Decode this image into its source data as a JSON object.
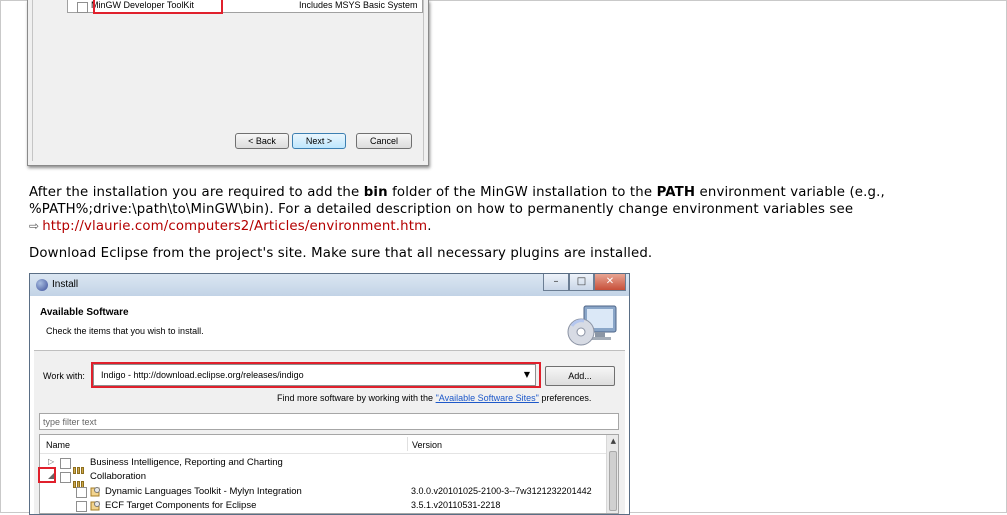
{
  "mingw_dialog": {
    "row_label": "MinGW Developer ToolKit",
    "row_description": "Includes MSYS Basic System",
    "back_button": "< Back",
    "next_button": "Next >",
    "cancel_button": "Cancel"
  },
  "article": {
    "para1_part1": "After the installation you are required to add the ",
    "para1_bold1": "bin",
    "para1_part2": " folder of the MinGW installation to the ",
    "para1_bold2": "PATH",
    "para1_part3": " environment variable (e.g.,",
    "para1_line2": "%PATH%;drive:\\path\\to\\MinGW\\bin). For a detailed description on how to permanently change environment variables see",
    "link_text": "http://vlaurie.com/computers2/Articles/environment.htm",
    "link_suffix": ".",
    "para2": "Download Eclipse from the project's site. Make sure that all necessary plugins are installed."
  },
  "install_dialog": {
    "title": "Install",
    "header_title": "Available Software",
    "header_subtitle": "Check the items that you wish to install.",
    "work_with_label": "Work with:",
    "work_with_value": "Indigo - http://download.eclipse.org/releases/indigo",
    "add_button": "Add...",
    "more_prefix": "Find more software by working with the ",
    "more_link": "\"Available Software Sites\"",
    "more_suffix": " preferences.",
    "filter_placeholder": "type filter text",
    "column_name": "Name",
    "column_version": "Version",
    "rows": [
      {
        "label": "Business Intelligence, Reporting and Charting",
        "version": ""
      },
      {
        "label": "Collaboration",
        "version": ""
      },
      {
        "label": "Dynamic Languages Toolkit - Mylyn Integration",
        "version": "3.0.0.v20101025-2100-3--7w3121232201442"
      },
      {
        "label": "ECF Target Components for Eclipse",
        "version": "3.5.1.v20110531-2218"
      }
    ]
  },
  "colors": {
    "highlight_red": "#e0202c",
    "link_red": "#b40000",
    "link_blue": "#1d58c9"
  }
}
